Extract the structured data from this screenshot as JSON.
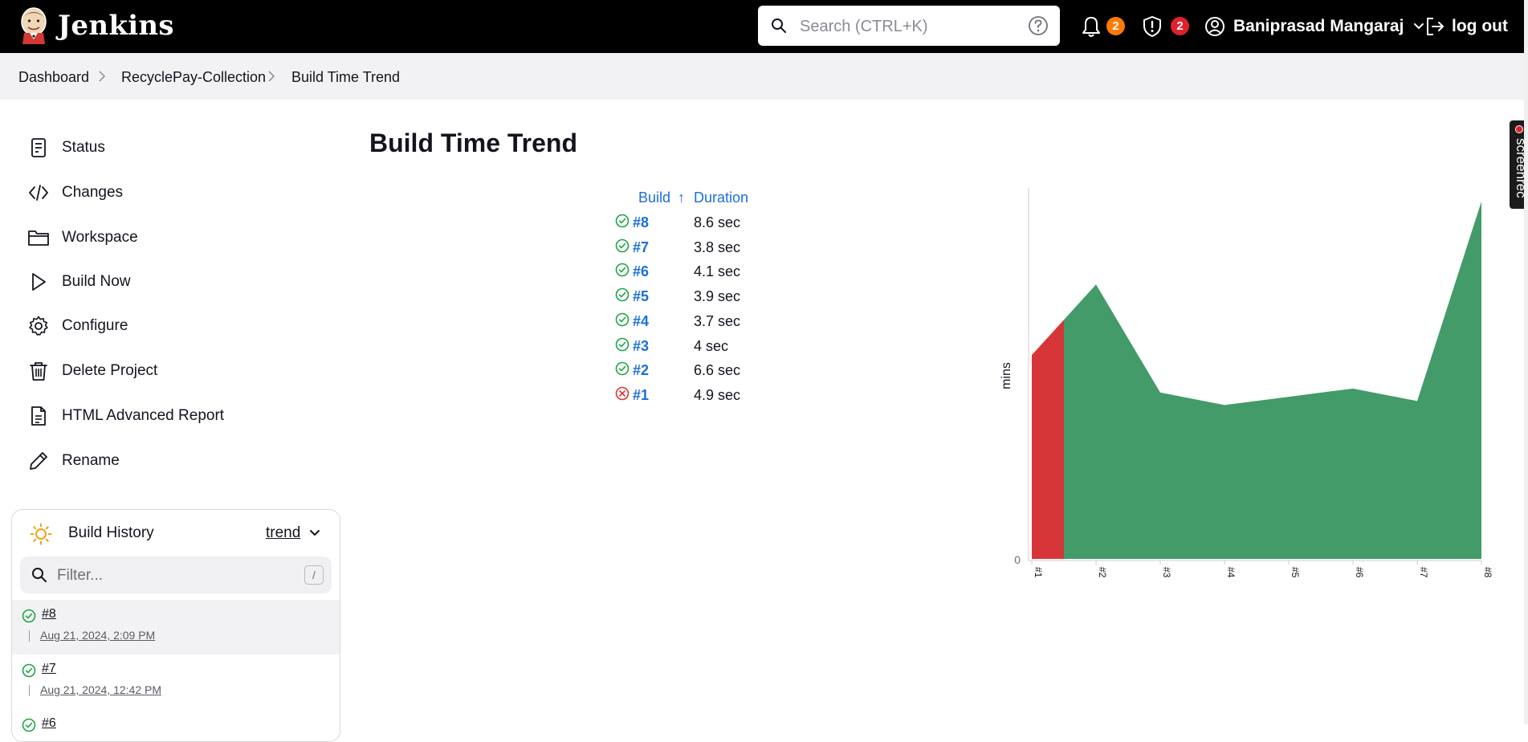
{
  "header": {
    "app_name": "Jenkins",
    "search_placeholder": "Search (CTRL+K)",
    "notifications_count": "2",
    "security_count": "2",
    "user_name": "Baniprasad Mangaraj",
    "logout_label": "log out",
    "colors": {
      "bar": "#000000",
      "notif_badge": "#ff7a00",
      "security_badge": "#e0212d"
    }
  },
  "breadcrumb": [
    "Dashboard",
    "RecyclePay-Collection",
    "Build Time Trend"
  ],
  "sidebar": {
    "tasks": [
      {
        "label": "Status",
        "icon": "document-icon"
      },
      {
        "label": "Changes",
        "icon": "code-icon"
      },
      {
        "label": "Workspace",
        "icon": "folder-icon"
      },
      {
        "label": "Build Now",
        "icon": "play-icon"
      },
      {
        "label": "Configure",
        "icon": "gear-icon"
      },
      {
        "label": "Delete Project",
        "icon": "trash-icon"
      },
      {
        "label": "HTML Advanced Report",
        "icon": "file-text-icon"
      },
      {
        "label": "Rename",
        "icon": "pencil-icon"
      }
    ],
    "build_history": {
      "title": "Build History",
      "trend_label": "trend",
      "filter_placeholder": "Filter...",
      "filter_shortcut": "/",
      "builds": [
        {
          "number": "#8",
          "date": "Aug 21, 2024, 2:09 PM",
          "status": "success"
        },
        {
          "number": "#7",
          "date": "Aug 21, 2024, 12:42 PM",
          "status": "success"
        },
        {
          "number": "#6",
          "date": "",
          "status": "success"
        }
      ]
    }
  },
  "main": {
    "title": "Build Time Trend",
    "table": {
      "headers": {
        "build": "Build",
        "sort_indicator": "↑",
        "duration": "Duration"
      },
      "rows": [
        {
          "build": "#8",
          "duration": "8.6 sec",
          "status": "success"
        },
        {
          "build": "#7",
          "duration": "3.8 sec",
          "status": "success"
        },
        {
          "build": "#6",
          "duration": "4.1 sec",
          "status": "success"
        },
        {
          "build": "#5",
          "duration": "3.9 sec",
          "status": "success"
        },
        {
          "build": "#4",
          "duration": "3.7 sec",
          "status": "success"
        },
        {
          "build": "#3",
          "duration": "4 sec",
          "status": "success"
        },
        {
          "build": "#2",
          "duration": "6.6 sec",
          "status": "success"
        },
        {
          "build": "#1",
          "duration": "4.9 sec",
          "status": "failure"
        }
      ]
    }
  },
  "chart_data": {
    "type": "area",
    "categories": [
      "#1",
      "#2",
      "#3",
      "#4",
      "#5",
      "#6",
      "#7",
      "#8"
    ],
    "ylabel": "mins",
    "y_tick_labels": [
      "0"
    ],
    "series": [
      {
        "values": [
          0.0817,
          0.11,
          0.0667,
          0.0617,
          0.065,
          0.0683,
          0.0633,
          0.1433
        ]
      }
    ],
    "ylim": [
      0,
      0.15
    ],
    "grid": false,
    "colors": {
      "success": "#439b69",
      "failure": "#d63638"
    }
  },
  "screenrec_label": "screenrec"
}
